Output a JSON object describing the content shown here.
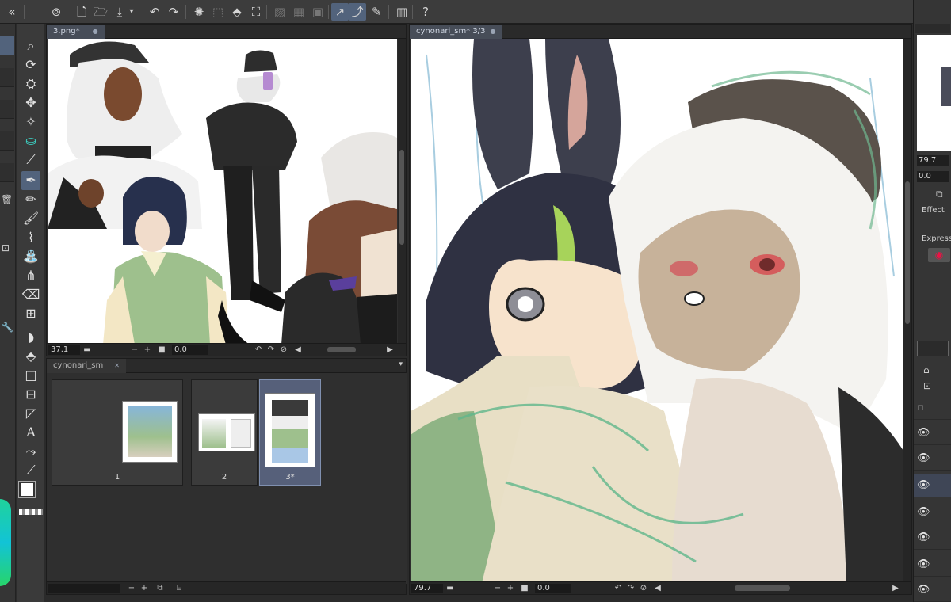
{
  "colors": {
    "accent": "#52637c",
    "panel": "#353535",
    "dark": "#2b2b2b"
  },
  "toolbar": {
    "icons": [
      "collapse-icon",
      "app-logo-icon",
      "new-file-icon",
      "open-folder-icon",
      "save-icon",
      "undo-icon",
      "redo-icon",
      "loading-icon",
      "clear-icon",
      "fill-icon",
      "transform-icon",
      "snap-off-icon",
      "snap-grid-icon",
      "snap-ruler-icon",
      "stabilizer-icon",
      "pen-curve-icon",
      "pen-edit-icon",
      "tablet-icon",
      "help-icon"
    ]
  },
  "windows": {
    "left": {
      "tab_title": "3.png*",
      "zoom": "37.1",
      "angle": "0.0"
    },
    "right": {
      "tab_title": "cynonari_sm* 3/3",
      "zoom": "79.7",
      "angle": "0.0"
    },
    "thumbs": {
      "tab_title": "cynonari_sm",
      "pages": [
        {
          "label": "1"
        },
        {
          "label": "2"
        },
        {
          "label": "3*"
        }
      ]
    }
  },
  "right_panel": {
    "zoom_value": "79.7",
    "angle_value": "0.0",
    "effect_label": "Effect",
    "express_label": "Express"
  }
}
